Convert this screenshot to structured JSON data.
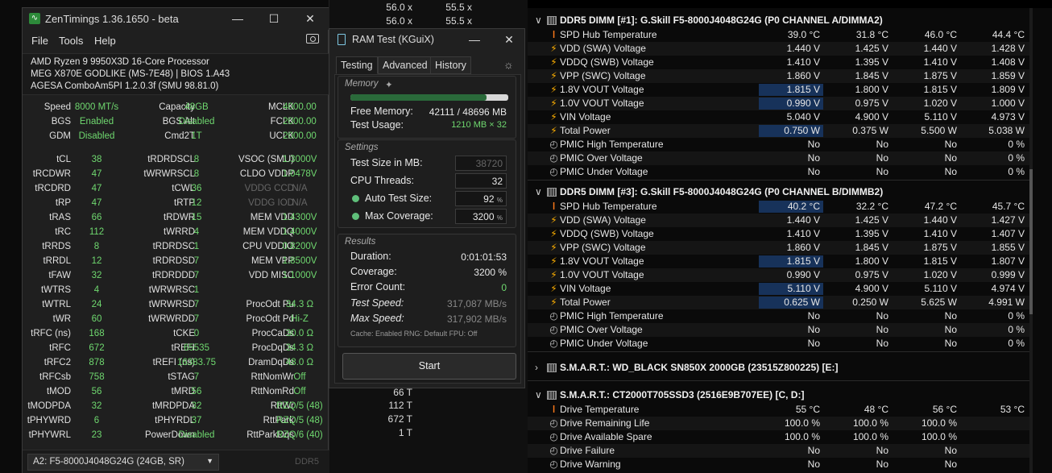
{
  "bg_rows": [
    {
      "a": "56.0 x",
      "b": "55.5 x"
    },
    {
      "a": "56.0 x",
      "b": "55.5 x"
    },
    {
      "a": "66 T",
      "b": ""
    },
    {
      "a": "112 T",
      "b": ""
    },
    {
      "a": "672 T",
      "b": ""
    },
    {
      "a": "1 T",
      "b": ""
    }
  ],
  "zentimings": {
    "title": "ZenTimings 1.36.1650 - beta",
    "menu": [
      "File",
      "Tools",
      "Help"
    ],
    "cpu": "AMD Ryzen 9 9950X3D 16-Core Processor",
    "board": "MEG X870E GODLIKE (MS-7E48) | BIOS 1.A43",
    "agesa": "AGESA ComboAm5PI 1.2.0.3f (SMU 98.81.0)",
    "header_rows": [
      [
        "Speed",
        "8000 MT/s",
        "Capacity",
        "48GB",
        "MCLK",
        "4000.00"
      ],
      [
        "BGS",
        "Enabled",
        "BGS Alt",
        "Disabled",
        "FCLK",
        "2000.00"
      ],
      [
        "GDM",
        "Disabled",
        "Cmd2T",
        "1T",
        "UCLK",
        "2000.00"
      ]
    ],
    "timing_rows": [
      [
        "tCL",
        "38",
        "tRDRDSCL",
        "8",
        "VSOC (SMU)",
        "1.3000V"
      ],
      [
        "tRCDWR",
        "47",
        "tWRWRSCL",
        "8",
        "CLDO VDDP",
        "1.0478V"
      ],
      [
        "tRCDRD",
        "47",
        "tCWL",
        "36",
        "VDDG CCD",
        "N/A"
      ],
      [
        "tRP",
        "47",
        "tRTP",
        "12",
        "VDDG IOD",
        "N/A"
      ],
      [
        "tRAS",
        "66",
        "tRDWR",
        "15",
        "MEM VDD",
        "1.4300V"
      ],
      [
        "tRC",
        "112",
        "tWRRD",
        "4",
        "MEM VDDQ",
        "1.4000V"
      ],
      [
        "tRRDS",
        "8",
        "tRDRDSC",
        "1",
        "CPU VDDIO",
        "0.8200V"
      ],
      [
        "tRRDL",
        "12",
        "tRDRDSD",
        "7",
        "MEM VPP",
        "1.8500V"
      ],
      [
        "tFAW",
        "32",
        "tRDRDDD",
        "7",
        "VDD MISC",
        "1.1000V"
      ],
      [
        "tWTRS",
        "4",
        "tWRWRSC",
        "1",
        "",
        ""
      ],
      [
        "tWTRL",
        "24",
        "tWRWRSD",
        "7",
        "ProcOdt Pu",
        "34.3 Ω"
      ],
      [
        "tWR",
        "60",
        "tWRWRDD",
        "7",
        "ProcOdt Pd",
        "Hi-Z"
      ],
      [
        "tRFC (ns)",
        "168",
        "tCKE",
        "0",
        "ProcCaDs",
        "30.0 Ω"
      ],
      [
        "tRFC",
        "672",
        "tREFI",
        "65535",
        "ProcDqDs",
        "34.3 Ω"
      ],
      [
        "tRFC2",
        "878",
        "tREFI (ns)",
        "16383.75",
        "DramDqDs",
        "48.0 Ω"
      ],
      [
        "tRFCsb",
        "758",
        "tSTAG",
        "7",
        "RttNomWr",
        "Off"
      ],
      [
        "tMOD",
        "56",
        "tMRD",
        "56",
        "RttNomRd",
        "Off"
      ],
      [
        "tMODPDA",
        "32",
        "tMRDPDA",
        "32",
        "RttWr",
        "RZQ/5 (48)"
      ],
      [
        "tPHYWRD",
        "6",
        "tPHYRDL",
        "37",
        "RttPark",
        "RZQ/5 (48)"
      ],
      [
        "tPHYWRL",
        "23",
        "PowerDown",
        "Disabled",
        "RttParkDqs",
        "RZQ/6 (40)"
      ]
    ],
    "dimm_select": "A2: F5-8000J4048G24G (24GB, SR)",
    "ddr_label": "DDR5"
  },
  "ramtest": {
    "title": "RAM Test (KGuiX)",
    "tabs": [
      "Testing",
      "Advanced",
      "History"
    ],
    "memory_group": "Memory",
    "memory_usage_fraction": 0.86,
    "free_memory_label": "Free Memory:",
    "free_memory": "42111 / 48696 MB",
    "test_usage_label": "Test Usage:",
    "test_usage": "1210 MB × 32",
    "settings_group": "Settings",
    "test_size_label": "Test Size in MB:",
    "test_size": "38720",
    "cpu_threads_label": "CPU Threads:",
    "cpu_threads": "32",
    "auto_test_size_label": "Auto Test Size:",
    "auto_test_size": "92",
    "max_coverage_label": "Max Coverage:",
    "max_coverage": "3200",
    "percent_unit": "%",
    "results_group": "Results",
    "duration_label": "Duration:",
    "duration": "0:01:01:53",
    "coverage_label": "Coverage:",
    "coverage": "3200 %",
    "error_count_label": "Error Count:",
    "error_count": "0",
    "test_speed_label": "Test Speed:",
    "test_speed": "317,087 MB/s",
    "max_speed_label": "Max Speed:",
    "max_speed": "317,902 MB/s",
    "cache_line": "Cache: Enabled  RNG: Default  FPU: Off",
    "start_button": "Start"
  },
  "sensors": {
    "dimm1_header": "DDR5 DIMM [#1]: G.Skill F5-8000J4048G24G (P0 CHANNEL A/DIMMA2)",
    "dimm1_rows": [
      {
        "icon": "thermometer-icon",
        "label": "SPD Hub Temperature",
        "v": [
          "39.0 °C",
          "31.8 °C",
          "46.0 °C",
          "44.4 °C"
        ]
      },
      {
        "icon": "bolt-icon",
        "label": "VDD (SWA) Voltage",
        "v": [
          "1.440 V",
          "1.425 V",
          "1.440 V",
          "1.428 V"
        ]
      },
      {
        "icon": "bolt-icon",
        "label": "VDDQ (SWB) Voltage",
        "v": [
          "1.410 V",
          "1.395 V",
          "1.410 V",
          "1.408 V"
        ]
      },
      {
        "icon": "bolt-icon",
        "label": "VPP (SWC) Voltage",
        "v": [
          "1.860 V",
          "1.845 V",
          "1.875 V",
          "1.859 V"
        ]
      },
      {
        "icon": "bolt-icon",
        "label": "1.8V VOUT Voltage",
        "v": [
          "1.815 V",
          "1.800 V",
          "1.815 V",
          "1.809 V"
        ],
        "hl": true
      },
      {
        "icon": "bolt-icon",
        "label": "1.0V VOUT Voltage",
        "v": [
          "0.990 V",
          "0.975 V",
          "1.020 V",
          "1.000 V"
        ],
        "hl": true
      },
      {
        "icon": "bolt-icon",
        "label": "VIN Voltage",
        "v": [
          "5.040 V",
          "4.900 V",
          "5.110 V",
          "4.973 V"
        ]
      },
      {
        "icon": "bolt-icon",
        "label": "Total Power",
        "v": [
          "0.750 W",
          "0.375 W",
          "5.500 W",
          "5.038 W"
        ],
        "hl": true
      },
      {
        "icon": "clock-icon",
        "label": "PMIC High Temperature",
        "v": [
          "No",
          "No",
          "No",
          "0 %"
        ]
      },
      {
        "icon": "clock-icon",
        "label": "PMIC Over Voltage",
        "v": [
          "No",
          "No",
          "No",
          "0 %"
        ]
      },
      {
        "icon": "clock-icon",
        "label": "PMIC Under Voltage",
        "v": [
          "No",
          "No",
          "No",
          "0 %"
        ]
      }
    ],
    "dimm3_header": "DDR5 DIMM [#3]: G.Skill F5-8000J4048G24G (P0 CHANNEL B/DIMMB2)",
    "dimm3_rows": [
      {
        "icon": "thermometer-icon",
        "label": "SPD Hub Temperature",
        "v": [
          "40.2 °C",
          "32.2 °C",
          "47.2 °C",
          "45.7 °C"
        ],
        "hl": true
      },
      {
        "icon": "bolt-icon",
        "label": "VDD (SWA) Voltage",
        "v": [
          "1.440 V",
          "1.425 V",
          "1.440 V",
          "1.427 V"
        ]
      },
      {
        "icon": "bolt-icon",
        "label": "VDDQ (SWB) Voltage",
        "v": [
          "1.410 V",
          "1.395 V",
          "1.410 V",
          "1.407 V"
        ]
      },
      {
        "icon": "bolt-icon",
        "label": "VPP (SWC) Voltage",
        "v": [
          "1.860 V",
          "1.845 V",
          "1.875 V",
          "1.855 V"
        ]
      },
      {
        "icon": "bolt-icon",
        "label": "1.8V VOUT Voltage",
        "v": [
          "1.815 V",
          "1.800 V",
          "1.815 V",
          "1.807 V"
        ],
        "hl": true
      },
      {
        "icon": "bolt-icon",
        "label": "1.0V VOUT Voltage",
        "v": [
          "0.990 V",
          "0.975 V",
          "1.020 V",
          "0.999 V"
        ]
      },
      {
        "icon": "bolt-icon",
        "label": "VIN Voltage",
        "v": [
          "5.110 V",
          "4.900 V",
          "5.110 V",
          "4.974 V"
        ],
        "hl": true
      },
      {
        "icon": "bolt-icon",
        "label": "Total Power",
        "v": [
          "0.625 W",
          "0.250 W",
          "5.625 W",
          "4.991 W"
        ],
        "hl": true
      },
      {
        "icon": "clock-icon",
        "label": "PMIC High Temperature",
        "v": [
          "No",
          "No",
          "No",
          "0 %"
        ]
      },
      {
        "icon": "clock-icon",
        "label": "PMIC Over Voltage",
        "v": [
          "No",
          "No",
          "No",
          "0 %"
        ]
      },
      {
        "icon": "clock-icon",
        "label": "PMIC Under Voltage",
        "v": [
          "No",
          "No",
          "No",
          "0 %"
        ]
      }
    ],
    "smart1_header": "S.M.A.R.T.: WD_BLACK SN850X 2000GB (23515Z800225) [E:]",
    "smart2_header": "S.M.A.R.T.: CT2000T705SSD3 (2516E9B707EE) [C, D:]",
    "smart2_rows": [
      {
        "icon": "thermometer-icon",
        "label": "Drive Temperature",
        "v": [
          "55 °C",
          "48 °C",
          "56 °C",
          "53 °C"
        ]
      },
      {
        "icon": "clock-icon",
        "label": "Drive Remaining Life",
        "v": [
          "100.0 %",
          "100.0 %",
          "100.0 %",
          ""
        ]
      },
      {
        "icon": "clock-icon",
        "label": "Drive Available Spare",
        "v": [
          "100.0 %",
          "100.0 %",
          "100.0 %",
          ""
        ]
      },
      {
        "icon": "clock-icon",
        "label": "Drive Failure",
        "v": [
          "No",
          "No",
          "No",
          ""
        ]
      },
      {
        "icon": "clock-icon",
        "label": "Drive Warning",
        "v": [
          "No",
          "No",
          "No",
          ""
        ]
      }
    ]
  }
}
